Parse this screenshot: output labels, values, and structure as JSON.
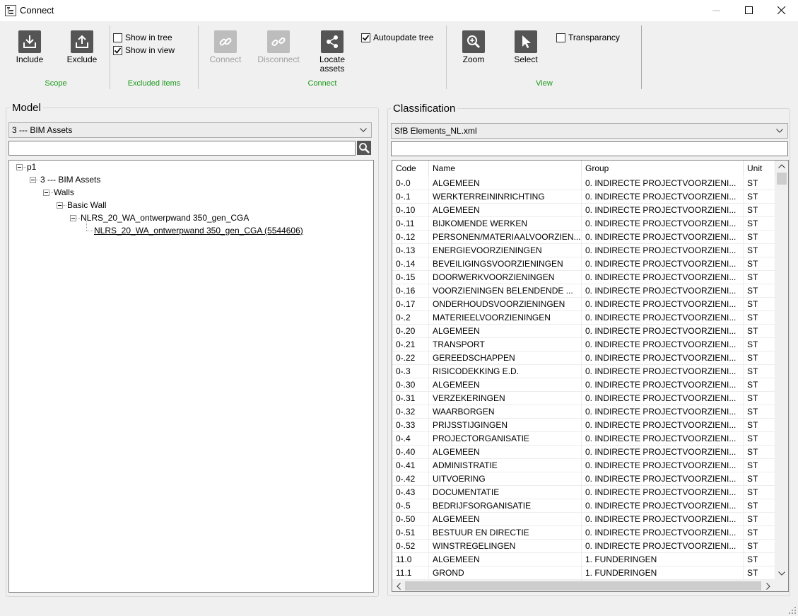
{
  "window": {
    "title": "Connect"
  },
  "ribbon": {
    "scope": {
      "include": "Include",
      "exclude": "Exclude",
      "group": "Scope"
    },
    "excluded_items": {
      "show_in_tree": "Show in tree",
      "show_in_tree_checked": false,
      "show_in_view": "Show in view",
      "show_in_view_checked": true,
      "group": "Excluded items"
    },
    "connect": {
      "connect": "Connect",
      "disconnect": "Disconnect",
      "locate_line1": "Locate",
      "locate_line2": "assets",
      "autoupdate_tree": "Autoupdate tree",
      "autoupdate_checked": true,
      "group": "Connect"
    },
    "view": {
      "zoom": "Zoom",
      "select": "Select",
      "transparancy": "Transparancy",
      "transparancy_checked": false,
      "group": "View"
    }
  },
  "model": {
    "title": "Model",
    "selected": "3 --- BIM Assets",
    "search_value": "",
    "tree": [
      {
        "label": "p1",
        "level": 0
      },
      {
        "label": "3 --- BIM Assets",
        "level": 1
      },
      {
        "label": "Walls",
        "level": 2
      },
      {
        "label": "Basic Wall",
        "level": 3
      },
      {
        "label": "NLRS_20_WA_ontwerpwand 350_gen_CGA",
        "level": 4
      },
      {
        "label": "NLRS_20_WA_ontwerpwand 350_gen_CGA (5544606)",
        "level": 5
      }
    ]
  },
  "classification": {
    "title": "Classification",
    "selected": "SfB Elements_NL.xml",
    "search_value": "",
    "columns": [
      "Code",
      "Name",
      "Group",
      "Unit"
    ],
    "rows": [
      [
        "0-.0",
        "ALGEMEEN",
        "0. INDIRECTE PROJECTVOORZIENI...",
        "ST"
      ],
      [
        "0-.1",
        "WERKTERREININRICHTING",
        "0. INDIRECTE PROJECTVOORZIENI...",
        "ST"
      ],
      [
        "0-.10",
        "ALGEMEEN",
        "0. INDIRECTE PROJECTVOORZIENI...",
        "ST"
      ],
      [
        "0-.11",
        "BIJKOMENDE WERKEN",
        "0. INDIRECTE PROJECTVOORZIENI...",
        "ST"
      ],
      [
        "0-.12",
        "PERSONEN/MATERIAALVOORZIEN...",
        "0. INDIRECTE PROJECTVOORZIENI...",
        "ST"
      ],
      [
        "0-.13",
        "ENERGIEVOORZIENINGEN",
        "0. INDIRECTE PROJECTVOORZIENI...",
        "ST"
      ],
      [
        "0-.14",
        "BEVEILIGINGSVOORZIENINGEN",
        "0. INDIRECTE PROJECTVOORZIENI...",
        "ST"
      ],
      [
        "0-.15",
        "DOORWERKVOORZIENINGEN",
        "0. INDIRECTE PROJECTVOORZIENI...",
        "ST"
      ],
      [
        "0-.16",
        "VOORZIENINGEN BELENDENDE ...",
        "0. INDIRECTE PROJECTVOORZIENI...",
        "ST"
      ],
      [
        "0-.17",
        "ONDERHOUDSVOORZIENINGEN",
        "0. INDIRECTE PROJECTVOORZIENI...",
        "ST"
      ],
      [
        "0-.2",
        "MATERIEELVOORZIENINGEN",
        "0. INDIRECTE PROJECTVOORZIENI...",
        "ST"
      ],
      [
        "0-.20",
        "ALGEMEEN",
        "0. INDIRECTE PROJECTVOORZIENI...",
        "ST"
      ],
      [
        "0-.21",
        "TRANSPORT",
        "0. INDIRECTE PROJECTVOORZIENI...",
        "ST"
      ],
      [
        "0-.22",
        "GEREEDSCHAPPEN",
        "0. INDIRECTE PROJECTVOORZIENI...",
        "ST"
      ],
      [
        "0-.3",
        "RISICODEKKING E.D.",
        "0. INDIRECTE PROJECTVOORZIENI...",
        "ST"
      ],
      [
        "0-.30",
        "ALGEMEEN",
        "0. INDIRECTE PROJECTVOORZIENI...",
        "ST"
      ],
      [
        "0-.31",
        "VERZEKERINGEN",
        "0. INDIRECTE PROJECTVOORZIENI...",
        "ST"
      ],
      [
        "0-.32",
        "WAARBORGEN",
        "0. INDIRECTE PROJECTVOORZIENI...",
        "ST"
      ],
      [
        "0-.33",
        "PRIJSSTIJGINGEN",
        "0. INDIRECTE PROJECTVOORZIENI...",
        "ST"
      ],
      [
        "0-.4",
        "PROJECTORGANISATIE",
        "0. INDIRECTE PROJECTVOORZIENI...",
        "ST"
      ],
      [
        "0-.40",
        "ALGEMEEN",
        "0. INDIRECTE PROJECTVOORZIENI...",
        "ST"
      ],
      [
        "0-.41",
        "ADMINISTRATIE",
        "0. INDIRECTE PROJECTVOORZIENI...",
        "ST"
      ],
      [
        "0-.42",
        "UITVOERING",
        "0. INDIRECTE PROJECTVOORZIENI...",
        "ST"
      ],
      [
        "0-.43",
        "DOCUMENTATIE",
        "0. INDIRECTE PROJECTVOORZIENI...",
        "ST"
      ],
      [
        "0-.5",
        "BEDRIJFSORGANISATIE",
        "0. INDIRECTE PROJECTVOORZIENI...",
        "ST"
      ],
      [
        "0-.50",
        "ALGEMEEN",
        "0. INDIRECTE PROJECTVOORZIENI...",
        "ST"
      ],
      [
        "0-.51",
        "BESTUUR EN DIRECTIE",
        "0. INDIRECTE PROJECTVOORZIENI...",
        "ST"
      ],
      [
        "0-.52",
        "WINSTREGELINGEN",
        "0. INDIRECTE PROJECTVOORZIENI...",
        "ST"
      ],
      [
        "11.0",
        "ALGEMEEN",
        "1. FUNDERINGEN",
        "ST"
      ],
      [
        "11.1",
        "GROND",
        "1. FUNDERINGEN",
        "ST"
      ]
    ]
  },
  "icons": {
    "include": "include-icon",
    "exclude": "exclude-icon",
    "connect": "link-icon",
    "disconnect": "unlink-icon",
    "locate": "share-nodes-icon",
    "zoom": "zoom-icon",
    "select": "cursor-icon"
  },
  "colors": {
    "group_label": "#1a9a1a",
    "icon_bg": "#555555",
    "icon_disabled": "#bdbdbd"
  }
}
